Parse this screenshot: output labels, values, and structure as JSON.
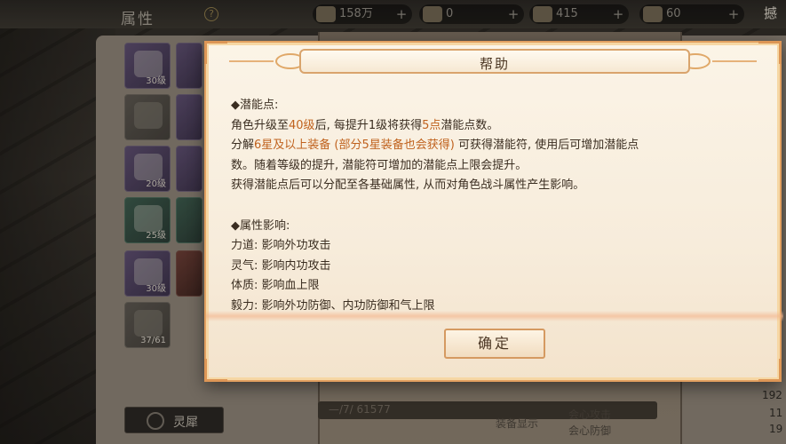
{
  "background": {
    "panel_title": "属性",
    "help_glyph": "?",
    "resources": [
      {
        "name": "coin-resource",
        "value": "158万"
      },
      {
        "name": "ingot-resource",
        "value": "0"
      },
      {
        "name": "gem-resource",
        "value": "415"
      },
      {
        "name": "gold-resource",
        "value": "60"
      }
    ],
    "top_right_fragment": "撼",
    "inventory": [
      {
        "level": "30级",
        "kind": "purple"
      },
      {
        "level": "",
        "kind": "purple"
      },
      {
        "level": "",
        "kind": "grey"
      },
      {
        "level": "",
        "kind": "purple"
      },
      {
        "level": "20级",
        "kind": "purple"
      },
      {
        "level": "",
        "kind": "purple"
      },
      {
        "level": "25级",
        "kind": "green"
      },
      {
        "level": "",
        "kind": "green"
      },
      {
        "level": "30级",
        "kind": "purple"
      },
      {
        "level": "",
        "kind": "red"
      },
      {
        "level": "37/61",
        "kind": "grey"
      }
    ],
    "lingxi_label": "灵犀",
    "bottom_bar_text": "—/7/ 61577",
    "equip_display_label": "装备显示",
    "crit_attack_label": "会心攻击",
    "crit_defense_label": "会心防御",
    "right_numbers": [
      "192",
      "11",
      "19"
    ]
  },
  "modal": {
    "title": "帮助",
    "sections": [
      {
        "heading": "◆潜能点:",
        "lines": [
          [
            {
              "t": "角色升级至"
            },
            {
              "t": "40级",
              "hl": true
            },
            {
              "t": "后, 每提升1级将获得"
            },
            {
              "t": "5点",
              "hl": true
            },
            {
              "t": "潜能点数。"
            }
          ],
          [
            {
              "t": "分解"
            },
            {
              "t": "6星及以上装备 (部分5星装备也会获得)",
              "hl": true
            },
            {
              "t": " 可获得潜能符, 使用后可增加潜能点"
            }
          ],
          [
            {
              "t": "数。随着等级的提升, 潜能符可增加的潜能点上限会提升。"
            }
          ],
          [
            {
              "t": "获得潜能点后可以分配至各基础属性, 从而对角色战斗属性产生影响。"
            }
          ]
        ]
      },
      {
        "heading": "◆属性影响:",
        "lines": [
          [
            {
              "t": "力道: 影响外功攻击"
            }
          ],
          [
            {
              "t": "灵气: 影响内功攻击"
            }
          ],
          [
            {
              "t": "体质: 影响血上限"
            }
          ],
          [
            {
              "t": "毅力: 影响外功防御、内功防御和气上限"
            }
          ]
        ]
      }
    ],
    "confirm_label": "确定"
  },
  "colors": {
    "highlight": "#c0621e",
    "modal_border": "#e2a060",
    "text": "#3a2d20"
  }
}
